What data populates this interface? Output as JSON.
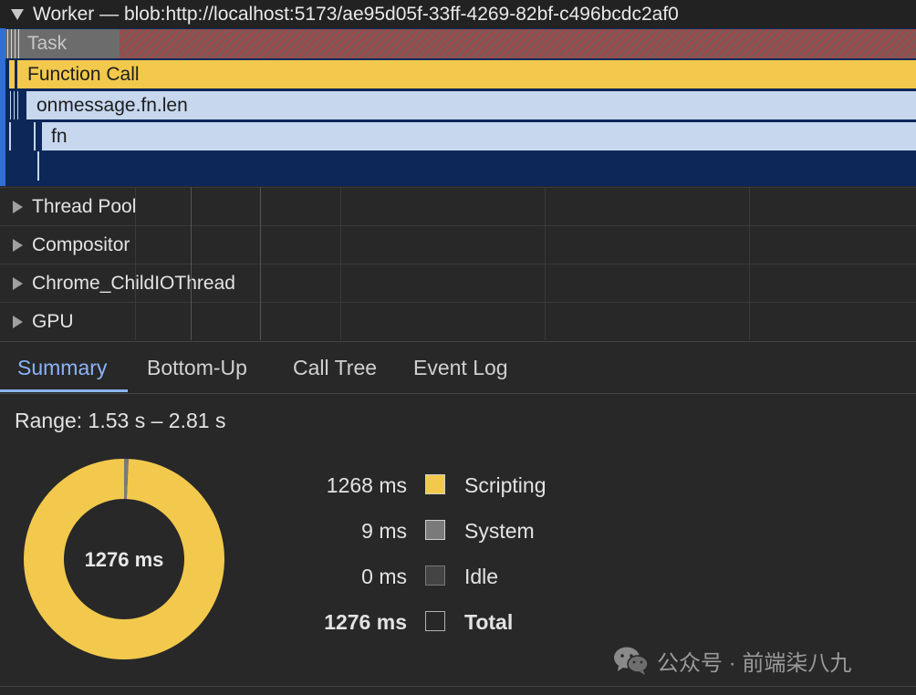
{
  "flame": {
    "worker_title": "Worker — blob:http://localhost:5173/ae95d05f-33ff-4269-82bf-c496bcdc2af0",
    "task_label": "Task",
    "function_call_label": "Function Call",
    "onmessage_label": "onmessage.fn.len",
    "fn_label": "fn"
  },
  "tracks": [
    {
      "label": "Thread Pool"
    },
    {
      "label": "Compositor"
    },
    {
      "label": "Chrome_ChildIOThread"
    },
    {
      "label": "GPU"
    }
  ],
  "tabs": [
    {
      "label": "Summary",
      "active": true
    },
    {
      "label": "Bottom-Up",
      "active": false
    },
    {
      "label": "Call Tree",
      "active": false
    },
    {
      "label": "Event Log",
      "active": false
    }
  ],
  "summary": {
    "range": "Range: 1.53 s – 2.81 s",
    "donut_center": "1276 ms",
    "rows": [
      {
        "value": "1268 ms",
        "name": "Scripting",
        "color": "#f2c94c",
        "bold": false
      },
      {
        "value": "9 ms",
        "name": "System",
        "color": "#7a7a7a",
        "bold": false
      },
      {
        "value": "0 ms",
        "name": "Idle",
        "color": "#444444",
        "bold": false
      },
      {
        "value": "1276 ms",
        "name": "Total",
        "color": "transparent",
        "bold": true
      }
    ]
  },
  "chart_data": {
    "type": "pie",
    "categories": [
      "Scripting",
      "System",
      "Idle"
    ],
    "values": [
      1268,
      9,
      0
    ],
    "total": 1276
  },
  "watermark": {
    "text": "公众号 · 前端柒八九"
  }
}
